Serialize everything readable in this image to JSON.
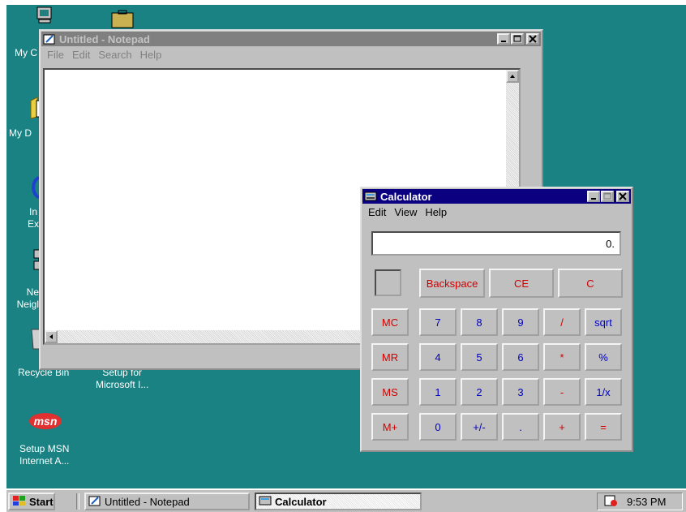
{
  "desktop": {
    "icons": [
      {
        "label": "My C"
      },
      {
        "label": "My D"
      },
      {
        "label": "In",
        "label2": "Ex"
      },
      {
        "label": "Ne",
        "label2": "Neigl"
      },
      {
        "label": "Recycle Bin"
      },
      {
        "label": "Setup for",
        "label2": "Microsoft I..."
      },
      {
        "label": "Setup MSN",
        "label2": "Internet A...",
        "logo": "msn"
      }
    ]
  },
  "notepad": {
    "title": "Untitled - Notepad",
    "menu": [
      "File",
      "Edit",
      "Search",
      "Help"
    ],
    "content": ""
  },
  "calculator": {
    "title": "Calculator",
    "menu": [
      "Edit",
      "View",
      "Help"
    ],
    "display": "0.",
    "top_buttons": [
      "Backspace",
      "CE",
      "C"
    ],
    "memory_buttons": [
      "MC",
      "MR",
      "MS",
      "M+"
    ],
    "rows": [
      [
        "7",
        "8",
        "9",
        "/",
        "sqrt"
      ],
      [
        "4",
        "5",
        "6",
        "*",
        "%"
      ],
      [
        "1",
        "2",
        "3",
        "-",
        "1/x"
      ],
      [
        "0",
        "+/-",
        ".",
        "+",
        "="
      ]
    ]
  },
  "taskbar": {
    "start_label": "Start",
    "buttons": [
      {
        "label": "Untitled - Notepad"
      },
      {
        "label": "Calculator"
      }
    ],
    "clock": "9:53 PM"
  },
  "colors": {
    "desktop": "#1a8282",
    "title_active": "#0a0080",
    "title_inactive": "#808080"
  }
}
